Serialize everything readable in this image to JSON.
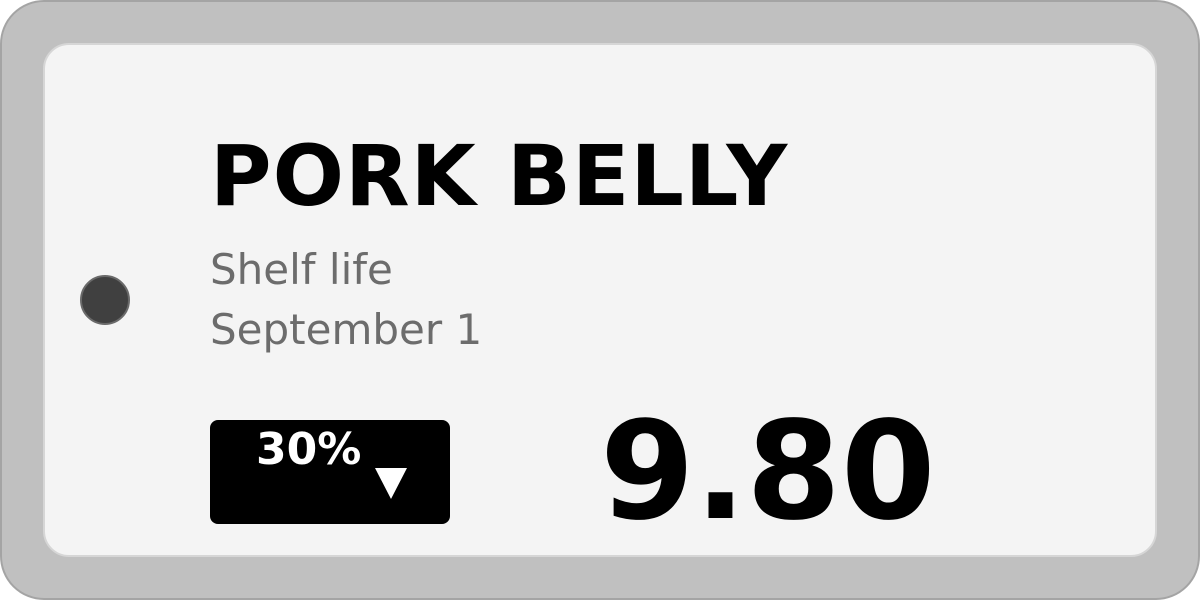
{
  "product": {
    "name": "PORK BELLY"
  },
  "shelf_life": {
    "label": "Shelf life",
    "date": "September 1"
  },
  "discount": {
    "text": "30%",
    "icon": "down-arrow-icon"
  },
  "price": {
    "value": "9.80"
  },
  "colors": {
    "frame": "#c0c0c0",
    "screen": "#f4f4f4",
    "text_primary": "#000000",
    "text_secondary": "#6c6c6c",
    "badge_background": "#000000",
    "badge_text": "#ffffff",
    "status_dot": "#404040"
  }
}
